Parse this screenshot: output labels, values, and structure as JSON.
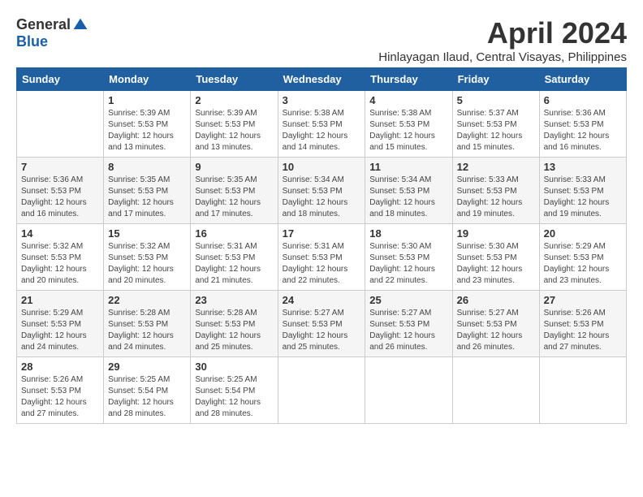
{
  "logo": {
    "general": "General",
    "blue": "Blue"
  },
  "title": "April 2024",
  "location": "Hinlayagan Ilaud, Central Visayas, Philippines",
  "weekdays": [
    "Sunday",
    "Monday",
    "Tuesday",
    "Wednesday",
    "Thursday",
    "Friday",
    "Saturday"
  ],
  "weeks": [
    [
      {
        "day": "",
        "info": ""
      },
      {
        "day": "1",
        "info": "Sunrise: 5:39 AM\nSunset: 5:53 PM\nDaylight: 12 hours\nand 13 minutes."
      },
      {
        "day": "2",
        "info": "Sunrise: 5:39 AM\nSunset: 5:53 PM\nDaylight: 12 hours\nand 13 minutes."
      },
      {
        "day": "3",
        "info": "Sunrise: 5:38 AM\nSunset: 5:53 PM\nDaylight: 12 hours\nand 14 minutes."
      },
      {
        "day": "4",
        "info": "Sunrise: 5:38 AM\nSunset: 5:53 PM\nDaylight: 12 hours\nand 15 minutes."
      },
      {
        "day": "5",
        "info": "Sunrise: 5:37 AM\nSunset: 5:53 PM\nDaylight: 12 hours\nand 15 minutes."
      },
      {
        "day": "6",
        "info": "Sunrise: 5:36 AM\nSunset: 5:53 PM\nDaylight: 12 hours\nand 16 minutes."
      }
    ],
    [
      {
        "day": "7",
        "info": "Sunrise: 5:36 AM\nSunset: 5:53 PM\nDaylight: 12 hours\nand 16 minutes."
      },
      {
        "day": "8",
        "info": "Sunrise: 5:35 AM\nSunset: 5:53 PM\nDaylight: 12 hours\nand 17 minutes."
      },
      {
        "day": "9",
        "info": "Sunrise: 5:35 AM\nSunset: 5:53 PM\nDaylight: 12 hours\nand 17 minutes."
      },
      {
        "day": "10",
        "info": "Sunrise: 5:34 AM\nSunset: 5:53 PM\nDaylight: 12 hours\nand 18 minutes."
      },
      {
        "day": "11",
        "info": "Sunrise: 5:34 AM\nSunset: 5:53 PM\nDaylight: 12 hours\nand 18 minutes."
      },
      {
        "day": "12",
        "info": "Sunrise: 5:33 AM\nSunset: 5:53 PM\nDaylight: 12 hours\nand 19 minutes."
      },
      {
        "day": "13",
        "info": "Sunrise: 5:33 AM\nSunset: 5:53 PM\nDaylight: 12 hours\nand 19 minutes."
      }
    ],
    [
      {
        "day": "14",
        "info": "Sunrise: 5:32 AM\nSunset: 5:53 PM\nDaylight: 12 hours\nand 20 minutes."
      },
      {
        "day": "15",
        "info": "Sunrise: 5:32 AM\nSunset: 5:53 PM\nDaylight: 12 hours\nand 20 minutes."
      },
      {
        "day": "16",
        "info": "Sunrise: 5:31 AM\nSunset: 5:53 PM\nDaylight: 12 hours\nand 21 minutes."
      },
      {
        "day": "17",
        "info": "Sunrise: 5:31 AM\nSunset: 5:53 PM\nDaylight: 12 hours\nand 22 minutes."
      },
      {
        "day": "18",
        "info": "Sunrise: 5:30 AM\nSunset: 5:53 PM\nDaylight: 12 hours\nand 22 minutes."
      },
      {
        "day": "19",
        "info": "Sunrise: 5:30 AM\nSunset: 5:53 PM\nDaylight: 12 hours\nand 23 minutes."
      },
      {
        "day": "20",
        "info": "Sunrise: 5:29 AM\nSunset: 5:53 PM\nDaylight: 12 hours\nand 23 minutes."
      }
    ],
    [
      {
        "day": "21",
        "info": "Sunrise: 5:29 AM\nSunset: 5:53 PM\nDaylight: 12 hours\nand 24 minutes."
      },
      {
        "day": "22",
        "info": "Sunrise: 5:28 AM\nSunset: 5:53 PM\nDaylight: 12 hours\nand 24 minutes."
      },
      {
        "day": "23",
        "info": "Sunrise: 5:28 AM\nSunset: 5:53 PM\nDaylight: 12 hours\nand 25 minutes."
      },
      {
        "day": "24",
        "info": "Sunrise: 5:27 AM\nSunset: 5:53 PM\nDaylight: 12 hours\nand 25 minutes."
      },
      {
        "day": "25",
        "info": "Sunrise: 5:27 AM\nSunset: 5:53 PM\nDaylight: 12 hours\nand 26 minutes."
      },
      {
        "day": "26",
        "info": "Sunrise: 5:27 AM\nSunset: 5:53 PM\nDaylight: 12 hours\nand 26 minutes."
      },
      {
        "day": "27",
        "info": "Sunrise: 5:26 AM\nSunset: 5:53 PM\nDaylight: 12 hours\nand 27 minutes."
      }
    ],
    [
      {
        "day": "28",
        "info": "Sunrise: 5:26 AM\nSunset: 5:53 PM\nDaylight: 12 hours\nand 27 minutes."
      },
      {
        "day": "29",
        "info": "Sunrise: 5:25 AM\nSunset: 5:54 PM\nDaylight: 12 hours\nand 28 minutes."
      },
      {
        "day": "30",
        "info": "Sunrise: 5:25 AM\nSunset: 5:54 PM\nDaylight: 12 hours\nand 28 minutes."
      },
      {
        "day": "",
        "info": ""
      },
      {
        "day": "",
        "info": ""
      },
      {
        "day": "",
        "info": ""
      },
      {
        "day": "",
        "info": ""
      }
    ]
  ]
}
